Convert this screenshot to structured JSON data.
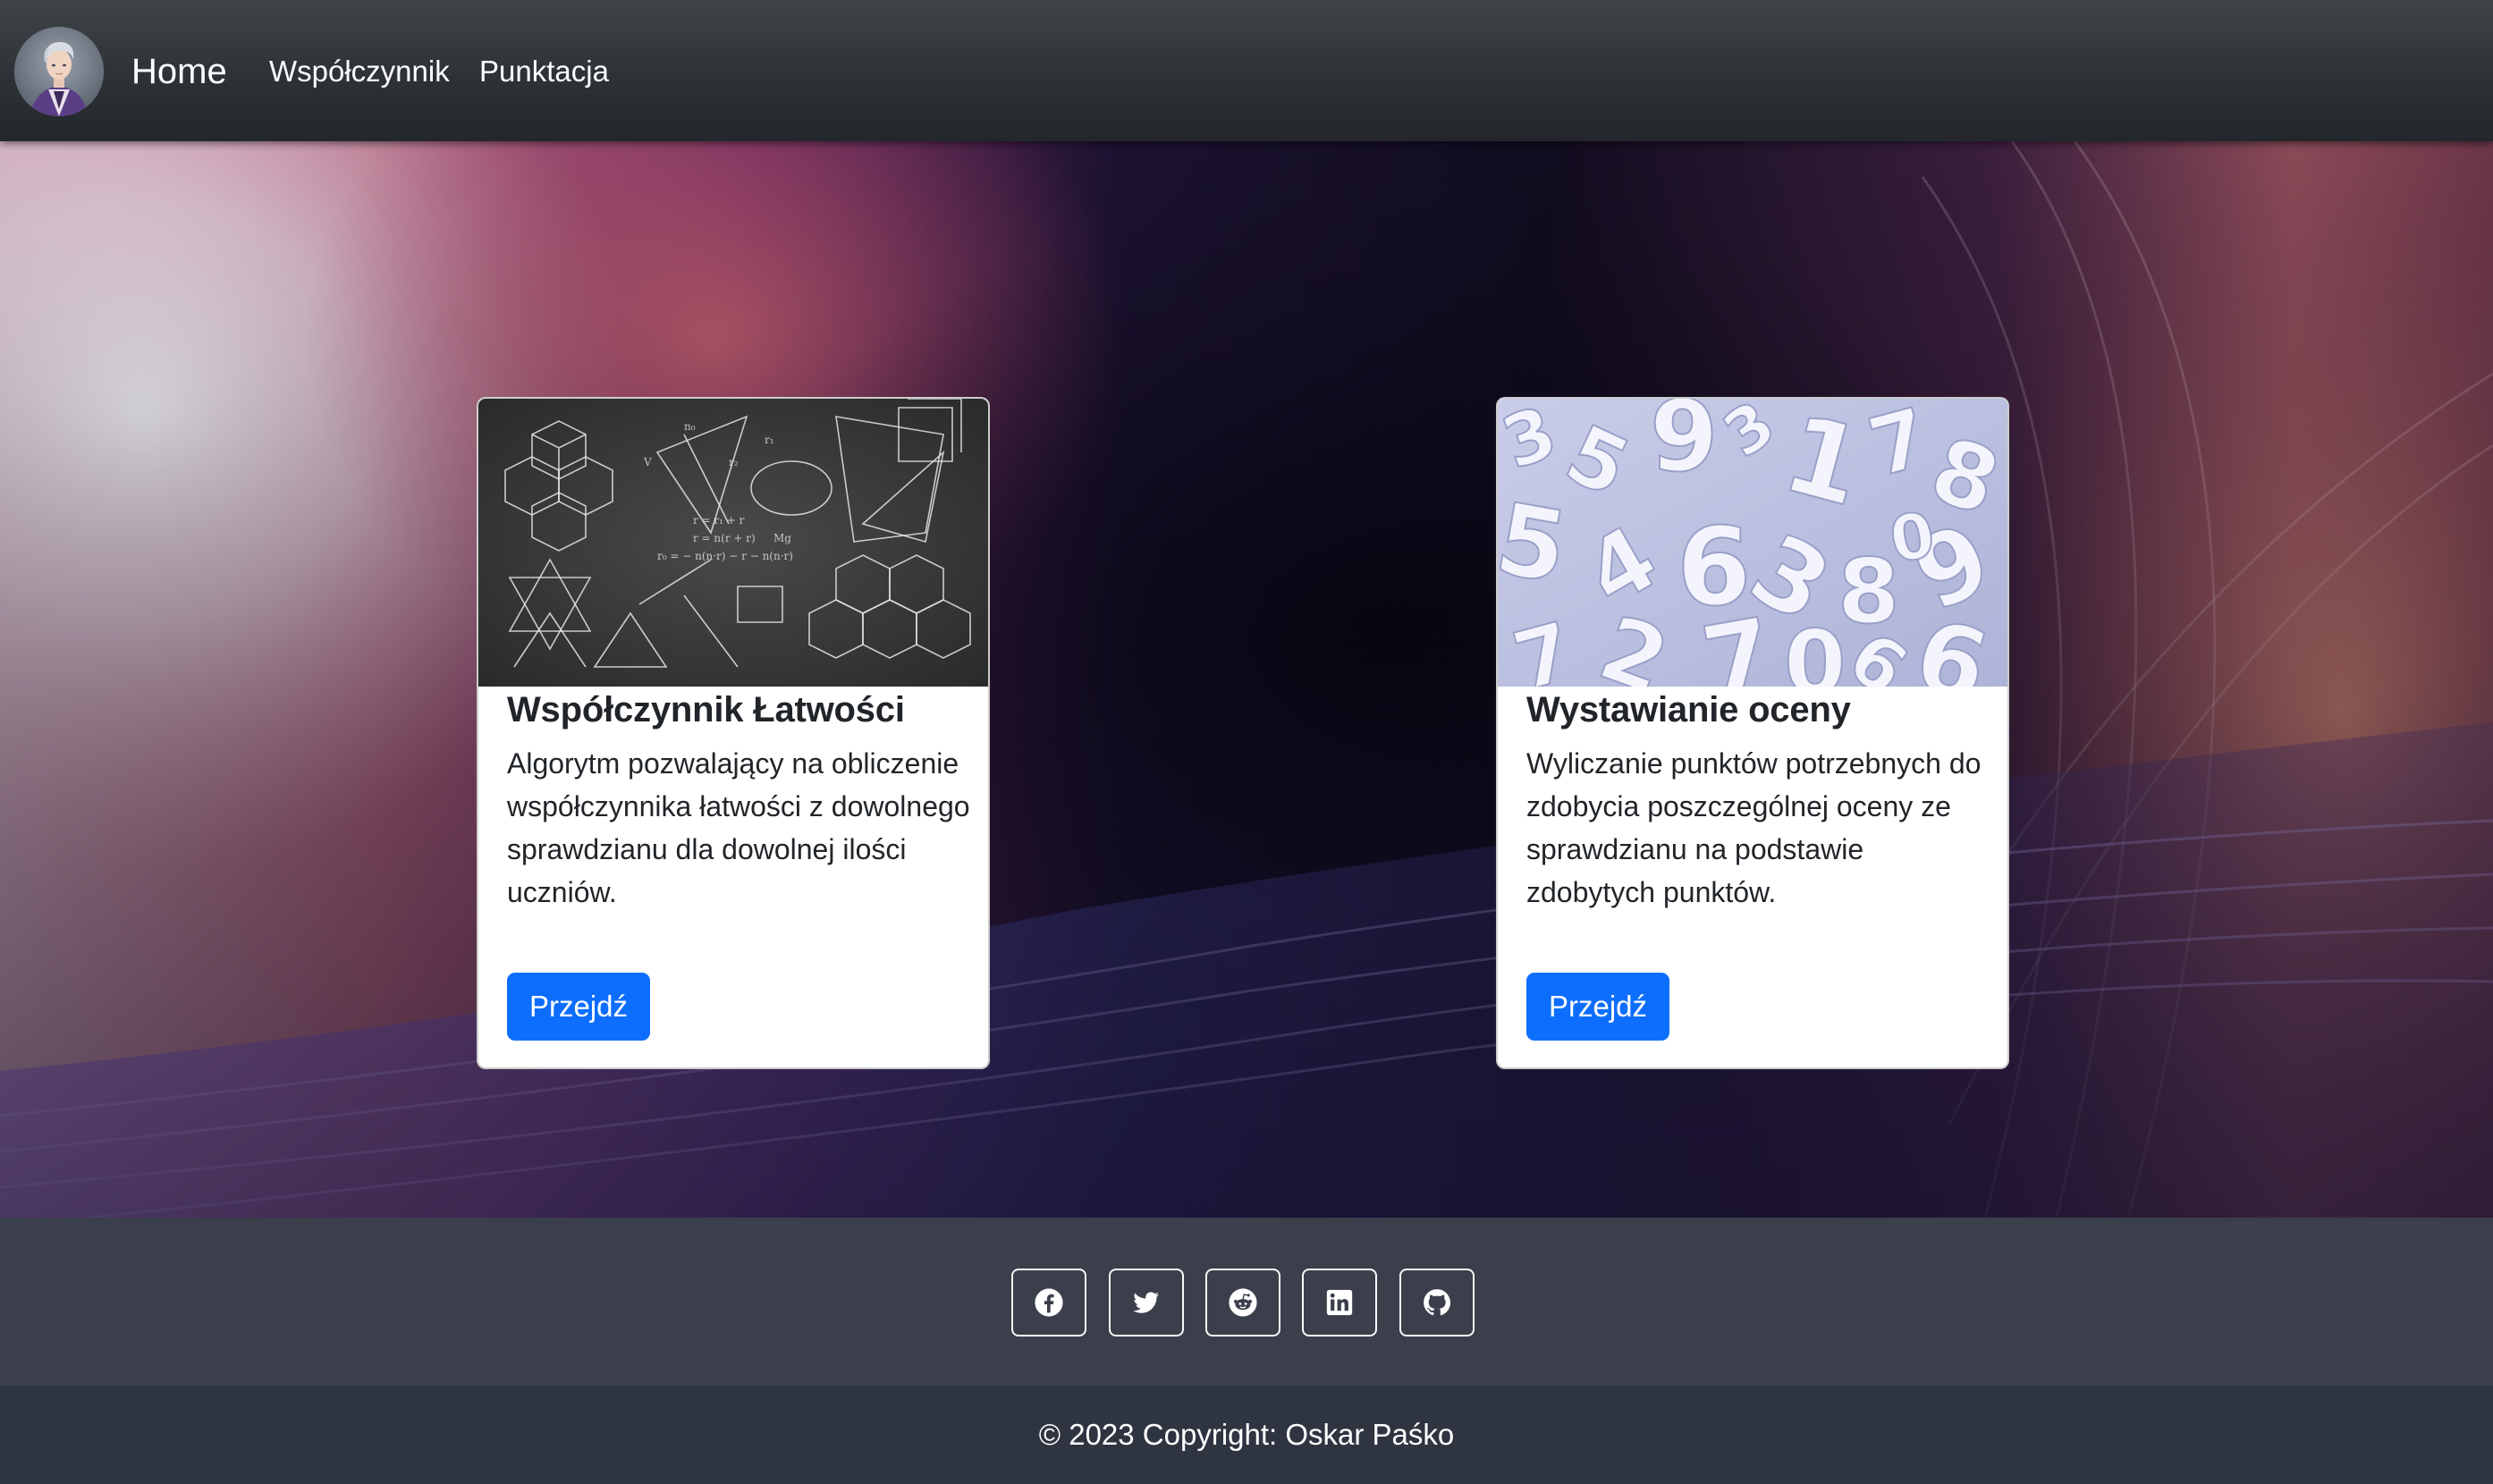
{
  "navbar": {
    "brand": "Home",
    "links": [
      "Współczynnik",
      "Punktacja"
    ]
  },
  "cards": [
    {
      "title": "Współczynnik Łatwości",
      "text": "Algorytm pozwalający na obliczenie współczynnika łatwości z dowolnego sprawdzianu dla dowolnej ilości uczniów.",
      "button": "Przejdź"
    },
    {
      "title": "Wystawianie oceny",
      "text": "Wyliczanie punktów potrzebnych do zdobycia poszczególnej oceny ze sprawdzianu na podstawie zdobytych punktów.",
      "button": "Przejdź"
    }
  ],
  "social": [
    "facebook-icon",
    "twitter-icon",
    "reddit-icon",
    "linkedin-icon",
    "github-icon"
  ],
  "footer": {
    "copyright": "© 2023 Copyright: Oskar Paśko"
  },
  "colors": {
    "primary": "#0d6efd",
    "navbar": "#2d3237",
    "footer_social": "#3a3f4b",
    "footer_copy": "#2f3441"
  }
}
